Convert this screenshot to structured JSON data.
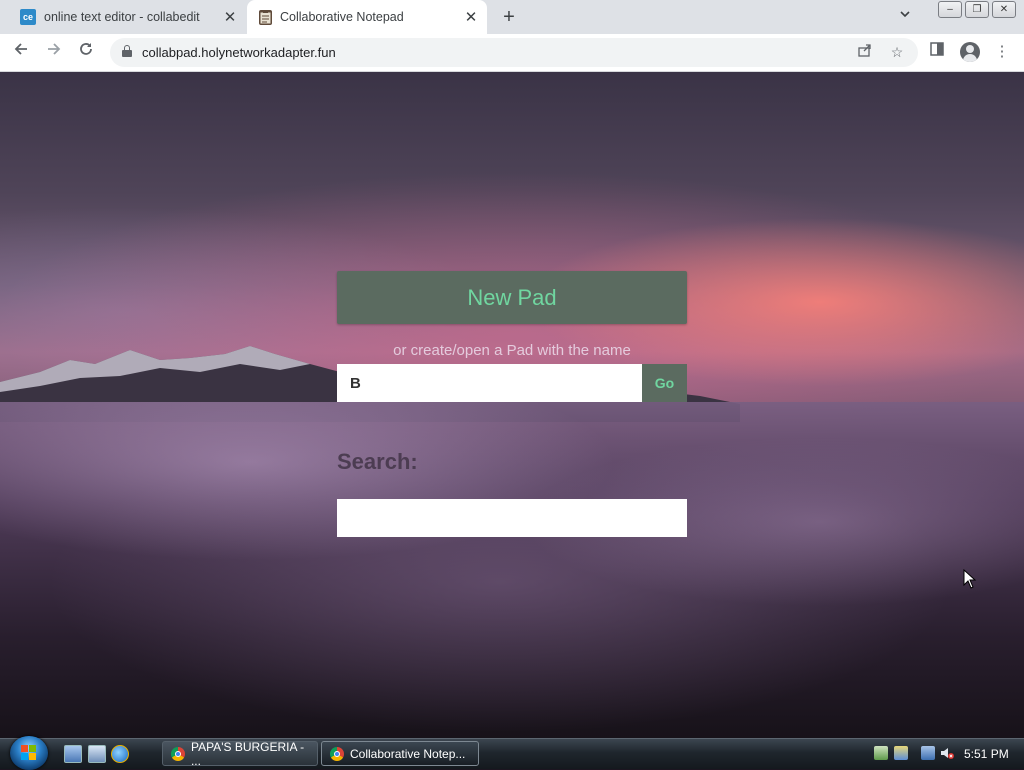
{
  "browser": {
    "tabs": [
      {
        "title": "online text editor - collabedit",
        "favicon_text": "ce",
        "favicon": "collabedit-icon",
        "active": false
      },
      {
        "title": "Collaborative Notepad",
        "favicon": "notepad-icon",
        "active": true
      }
    ],
    "close_glyph": "✕",
    "new_tab_glyph": "+",
    "url": "collabpad.holynetworkadapter.fun"
  },
  "page": {
    "new_pad_label": "New Pad",
    "hint_text": "or create/open a Pad with the name",
    "pad_name_value": "B",
    "go_label": "Go",
    "search_label": "Search:",
    "search_value": ""
  },
  "taskbar": {
    "tasks": [
      {
        "label": "PAPA'S BURGERIA - ...",
        "active": false
      },
      {
        "label": "Collaborative Notep...",
        "active": true
      }
    ],
    "clock": "5:51 PM"
  },
  "colors": {
    "button_bg": "#5b6b60",
    "button_text": "#70d6a0"
  }
}
